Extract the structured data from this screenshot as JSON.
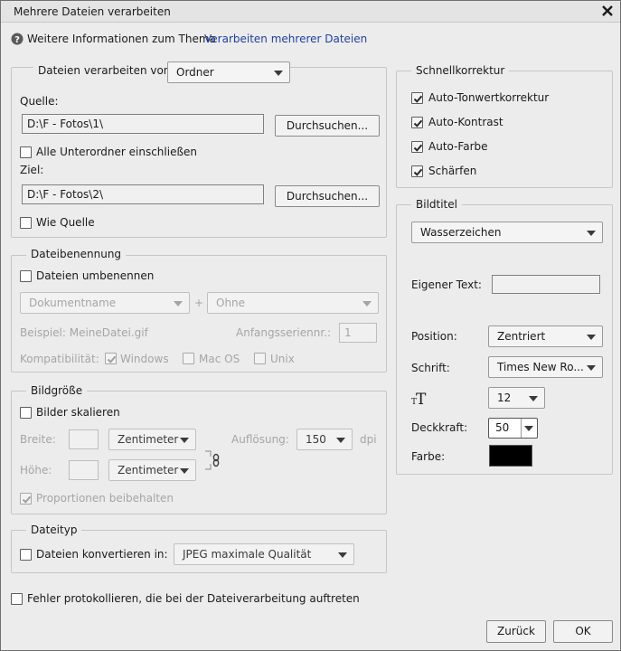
{
  "window": {
    "title": "Mehrere Dateien verarbeiten"
  },
  "info": {
    "prefix": "Weitere Informationen zum Thema",
    "link": "Verarbeiten mehrerer Dateien"
  },
  "source": {
    "process_label": "Dateien verarbeiten von:",
    "process_value": "Ordner",
    "source_label": "Quelle:",
    "source_path": "D:\\F - Fotos\\1\\",
    "browse_label": "Durchsuchen...",
    "subfolders_label": "Alle Unterordner einschließen",
    "subfolders_checked": false,
    "dest_label": "Ziel:",
    "dest_path": "D:\\F - Fotos\\2\\",
    "browse2_label": "Durchsuchen...",
    "same_as_source_label": "Wie Quelle",
    "same_as_source_checked": false
  },
  "naming": {
    "legend": "Dateibenennung",
    "rename_label": "Dateien umbenennen",
    "rename_checked": false,
    "part1": "Dokumentname",
    "plus": "+",
    "part2": "Ohne",
    "example_label": "Beispiel: MeineDatei.gif",
    "start_serial_label": "Anfangsseriennr.:",
    "start_serial_value": "1",
    "compat_label": "Kompatibilität:",
    "windows_label": "Windows",
    "windows_checked": true,
    "macos_label": "Mac OS",
    "macos_checked": false,
    "unix_label": "Unix",
    "unix_checked": false
  },
  "size": {
    "legend": "Bildgröße",
    "scale_label": "Bilder skalieren",
    "scale_checked": false,
    "width_label": "Breite:",
    "width_value": "",
    "width_unit": "Zentimeter",
    "resolution_label": "Auflösung:",
    "resolution_value": "150",
    "resolution_unit": "dpi",
    "height_label": "Höhe:",
    "height_value": "",
    "height_unit": "Zentimeter",
    "proportions_label": "Proportionen beibehalten",
    "proportions_checked": true
  },
  "filetype": {
    "legend": "Dateityp",
    "convert_label": "Dateien konvertieren in:",
    "convert_checked": false,
    "format_value": "JPEG maximale Qualität"
  },
  "log": {
    "label": "Fehler protokollieren, die bei der Dateiverarbeitung auftreten",
    "checked": false
  },
  "quickfix": {
    "legend": "Schnellkorrektur",
    "items": [
      {
        "label": "Auto-Tonwertkorrektur",
        "checked": true
      },
      {
        "label": "Auto-Kontrast",
        "checked": true
      },
      {
        "label": "Auto-Farbe",
        "checked": true
      },
      {
        "label": "Schärfen",
        "checked": true
      }
    ]
  },
  "caption": {
    "legend": "Bildtitel",
    "type_value": "Wasserzeichen",
    "custom_text_label": "Eigener Text:",
    "custom_text_value": "",
    "position_label": "Position:",
    "position_value": "Zentriert",
    "font_label": "Schrift:",
    "font_value": "Times New Ro...",
    "font_size_value": "12",
    "opacity_label": "Deckkraft:",
    "opacity_value": "50",
    "color_label": "Farbe:",
    "color_value": "#000000"
  },
  "footer": {
    "back_label": "Zurück",
    "ok_label": "OK"
  }
}
